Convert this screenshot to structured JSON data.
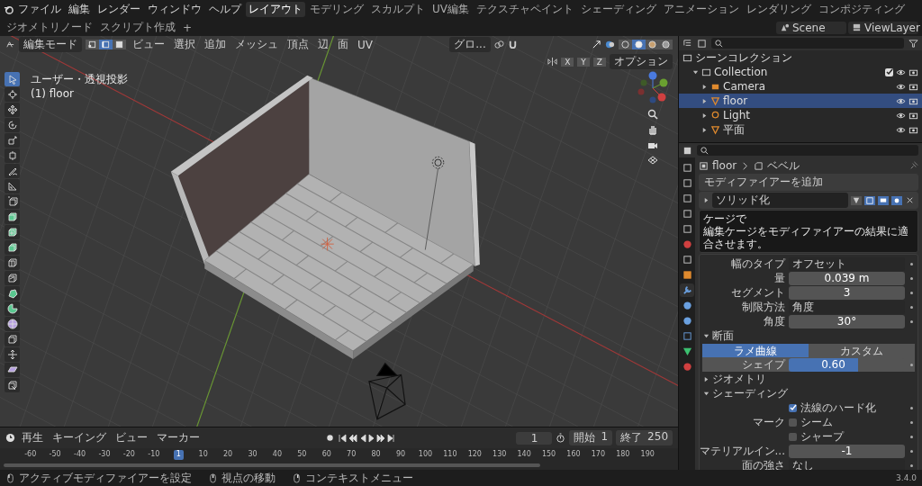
{
  "menubar": {
    "menus": [
      "ファイル",
      "編集",
      "レンダー",
      "ウィンドウ",
      "ヘルプ"
    ],
    "workspaces": [
      {
        "label": "レイアウト",
        "selected": true
      },
      {
        "label": "モデリング",
        "selected": false
      },
      {
        "label": "スカルプト",
        "selected": false
      },
      {
        "label": "UV編集",
        "selected": false
      },
      {
        "label": "テクスチャペイント",
        "selected": false
      },
      {
        "label": "シェーディング",
        "selected": false
      },
      {
        "label": "アニメーション",
        "selected": false
      },
      {
        "label": "レンダリング",
        "selected": false
      },
      {
        "label": "コンポジティング",
        "selected": false
      },
      {
        "label": "ジオメトリノード",
        "selected": false
      },
      {
        "label": "スクリプト作成",
        "selected": false
      }
    ],
    "add_tab": "+",
    "scene": "Scene",
    "view_layer": "ViewLayer"
  },
  "viewport": {
    "mode": "編集モード",
    "select_modes": [
      {
        "kind": "vertex",
        "selected": false
      },
      {
        "kind": "edge",
        "selected": true
      },
      {
        "kind": "face",
        "selected": false
      }
    ],
    "menus": [
      "ビュー",
      "選択",
      "追加",
      "メッシュ",
      "頂点",
      "辺",
      "面",
      "UV"
    ],
    "orientation": "グロ...",
    "shading": [
      {
        "kind": "wireframe",
        "selected": false
      },
      {
        "kind": "solid",
        "selected": true
      },
      {
        "kind": "material",
        "selected": false
      },
      {
        "kind": "rendered",
        "selected": false
      }
    ],
    "mirror_axes": [
      {
        "label": "X",
        "on": false
      },
      {
        "label": "Y",
        "on": false
      },
      {
        "label": "Z",
        "on": false
      }
    ],
    "options": "オプション",
    "view_name": "ユーザー・透視投影",
    "object_info": "(1) floor",
    "tools": [
      {
        "kind": "select",
        "selected": true
      },
      {
        "kind": "cursor",
        "selected": false
      },
      {
        "kind": "move",
        "selected": false
      },
      {
        "kind": "rotate",
        "selected": false
      },
      {
        "kind": "scale",
        "selected": false
      },
      {
        "kind": "transform",
        "selected": false
      },
      {
        "kind": "annotate",
        "selected": false
      },
      {
        "kind": "measure",
        "selected": false
      },
      {
        "kind": "addcube",
        "selected": false
      },
      {
        "kind": "extrude",
        "selected": false
      },
      {
        "kind": "inset",
        "selected": false
      },
      {
        "kind": "bevel",
        "selected": false
      },
      {
        "kind": "loopcut",
        "selected": false
      },
      {
        "kind": "knife",
        "selected": false
      },
      {
        "kind": "polybuild",
        "selected": false
      },
      {
        "kind": "spin",
        "selected": false
      },
      {
        "kind": "smooth",
        "selected": false
      },
      {
        "kind": "slide",
        "selected": false
      },
      {
        "kind": "shrink",
        "selected": false
      },
      {
        "kind": "shear",
        "selected": false
      },
      {
        "kind": "rip",
        "selected": false
      }
    ]
  },
  "outliner": {
    "root": {
      "label": "シーンコレクション",
      "kind": "scene",
      "selected": false,
      "children": [
        {
          "label": "Collection",
          "kind": "collection",
          "expanded": true,
          "checked": true,
          "selected": false,
          "children": [
            {
              "label": "Camera",
              "kind": "camera",
              "expanded": false,
              "selected": false
            },
            {
              "label": "floor",
              "kind": "mesh",
              "expanded": false,
              "selected": true
            },
            {
              "label": "Light",
              "kind": "light",
              "expanded": false,
              "selected": false
            },
            {
              "label": "平面",
              "kind": "mesh",
              "expanded": false,
              "selected": false
            }
          ]
        }
      ]
    }
  },
  "properties": {
    "tabs": [
      {
        "kind": "tool",
        "selected": false
      },
      {
        "kind": "render",
        "selected": false
      },
      {
        "kind": "output",
        "selected": false
      },
      {
        "kind": "view",
        "selected": false
      },
      {
        "kind": "scene",
        "selected": false
      },
      {
        "kind": "world",
        "selected": false
      },
      {
        "kind": "collection",
        "selected": false
      },
      {
        "kind": "object",
        "selected": false
      },
      {
        "kind": "modifier",
        "selected": true
      },
      {
        "kind": "particles",
        "selected": false
      },
      {
        "kind": "physics",
        "selected": false
      },
      {
        "kind": "constraints",
        "selected": false
      },
      {
        "kind": "data",
        "selected": false
      },
      {
        "kind": "material",
        "selected": false
      }
    ],
    "breadcrumb": [
      "floor",
      "ベベル"
    ],
    "add_modifier": "モディファイアーを追加",
    "modifier": {
      "name": "ソリッド化",
      "expanded": false,
      "toggles": [
        {
          "kind": "cage",
          "on": false
        },
        {
          "kind": "editmode",
          "on": true
        },
        {
          "kind": "viewport",
          "on": true
        },
        {
          "kind": "render",
          "on": true
        }
      ]
    },
    "tooltip": {
      "title": "ケージで",
      "text": "編集ケージをモディファイアーの結果に適合させます。"
    },
    "fields": [
      {
        "kind": "dropdown",
        "label": "幅のタイプ",
        "value": "オフセット"
      },
      {
        "kind": "number",
        "label": "量",
        "value": "0.039 m"
      },
      {
        "kind": "number",
        "label": "セグメント",
        "value": "3"
      },
      {
        "kind": "dropdown",
        "label": "制限方法",
        "value": "角度"
      },
      {
        "kind": "number",
        "label": "角度",
        "value": "30°"
      },
      {
        "kind": "section",
        "label": "断面",
        "expanded": true
      },
      {
        "kind": "segmented",
        "options": [
          {
            "label": "ラメ曲線",
            "selected": true
          },
          {
            "label": "カスタム",
            "selected": false
          }
        ]
      },
      {
        "kind": "slider",
        "label": "シェイプ",
        "value": "0.60",
        "level": 0.6
      },
      {
        "kind": "section",
        "label": "ジオメトリ",
        "expanded": false
      },
      {
        "kind": "section",
        "label": "シェーディング",
        "expanded": true
      },
      {
        "kind": "checkbox",
        "text": "法線のハード化",
        "checked": true
      },
      {
        "kind": "checkbox",
        "label": "マーク",
        "text": "シーム",
        "checked": false
      },
      {
        "kind": "checkbox",
        "text": "シャープ",
        "checked": false
      },
      {
        "kind": "number",
        "label": "マテリアルイン...",
        "value": "-1"
      },
      {
        "kind": "dropdown",
        "label": "面の強さ",
        "value": "なし"
      }
    ]
  },
  "timeline": {
    "menus": [
      "再生",
      "キーイング",
      "ビュー",
      "マーカー"
    ],
    "current_frame": "1",
    "start_label": "開始",
    "start": "1",
    "end_label": "終了",
    "end": "250",
    "ticks": [
      {
        "label": "-60",
        "selected": false
      },
      {
        "label": "-50",
        "selected": false
      },
      {
        "label": "-40",
        "selected": false
      },
      {
        "label": "-30",
        "selected": false
      },
      {
        "label": "-20",
        "selected": false
      },
      {
        "label": "-10",
        "selected": false
      },
      {
        "label": "1",
        "selected": true
      },
      {
        "label": "10",
        "selected": false
      },
      {
        "label": "20",
        "selected": false
      },
      {
        "label": "30",
        "selected": false
      },
      {
        "label": "40",
        "selected": false
      },
      {
        "label": "50",
        "selected": false
      },
      {
        "label": "60",
        "selected": false
      },
      {
        "label": "70",
        "selected": false
      },
      {
        "label": "80",
        "selected": false
      },
      {
        "label": "90",
        "selected": false
      },
      {
        "label": "100",
        "selected": false
      },
      {
        "label": "110",
        "selected": false
      },
      {
        "label": "120",
        "selected": false
      },
      {
        "label": "130",
        "selected": false
      },
      {
        "label": "140",
        "selected": false
      },
      {
        "label": "150",
        "selected": false
      },
      {
        "label": "160",
        "selected": false
      },
      {
        "label": "170",
        "selected": false
      },
      {
        "label": "180",
        "selected": false
      },
      {
        "label": "190",
        "selected": false
      }
    ]
  },
  "status_bar": {
    "hints": [
      {
        "kind": "left",
        "text": "アクティブモディファイアーを設定"
      },
      {
        "kind": "middle",
        "text": "視点の移動"
      },
      {
        "kind": "right",
        "text": "コンテキストメニュー"
      }
    ],
    "version": "3.4.0"
  }
}
